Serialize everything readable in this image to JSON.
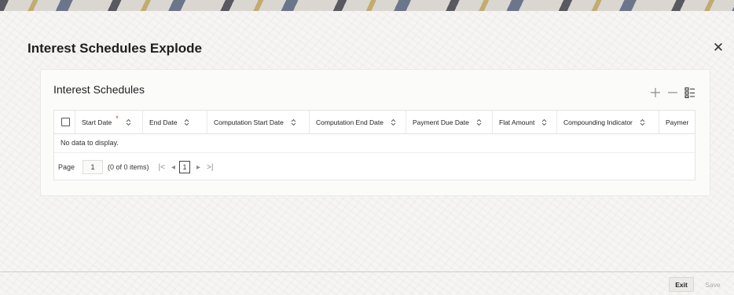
{
  "dialog": {
    "title": "Interest Schedules Explode",
    "close_icon": "close-icon"
  },
  "panel": {
    "title": "Interest Schedules",
    "tools": [
      "add-row-icon",
      "delete-row-icon",
      "single-record-view-icon"
    ]
  },
  "grid": {
    "columns": [
      {
        "label": "Start Date",
        "required": true,
        "required_marker": "*",
        "sortable": true
      },
      {
        "label": "End Date",
        "required": false,
        "sortable": true
      },
      {
        "label": "Computation Start Date",
        "required": false,
        "sortable": true
      },
      {
        "label": "Computation End Date",
        "required": false,
        "sortable": true
      },
      {
        "label": "Payment Due Date",
        "required": false,
        "sortable": true
      },
      {
        "label": "Flat Amount",
        "required": false,
        "sortable": true
      },
      {
        "label": "Compounding Indicator",
        "required": false,
        "sortable": true
      },
      {
        "label": "Paymer",
        "required": false,
        "sortable": false
      }
    ],
    "empty_message": "No data to display.",
    "rows": []
  },
  "pagination": {
    "page_label": "Page",
    "page_input_value": "1",
    "item_count": "(0 of 0 items)",
    "first_icon": "|<",
    "prev_icon": "◂",
    "current_page": "1",
    "next_icon": "▸",
    "last_icon": ">|"
  },
  "footer": {
    "exit_label": "Exit",
    "save_label": "Save"
  },
  "colors": {
    "required_marker": "#c0392b",
    "disabled_text": "#a9a9a9"
  }
}
